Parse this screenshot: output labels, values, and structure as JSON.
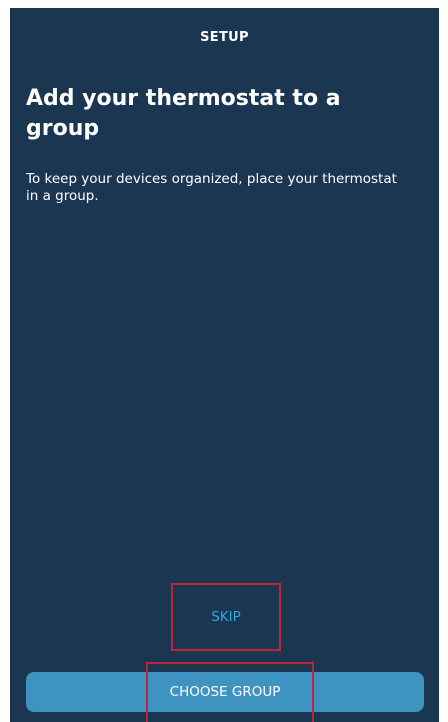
{
  "header": {
    "label": "SETUP"
  },
  "content": {
    "title": "Add your thermostat to a group",
    "description": "To keep your devices organized, place your thermostat in a group."
  },
  "actions": {
    "skip_label": "SKIP",
    "choose_label": "CHOOSE GROUP"
  },
  "colors": {
    "background": "#1a3650",
    "accent_link": "#33a6e0",
    "primary_button": "#3e93c0",
    "highlight_box": "#c0243a"
  }
}
